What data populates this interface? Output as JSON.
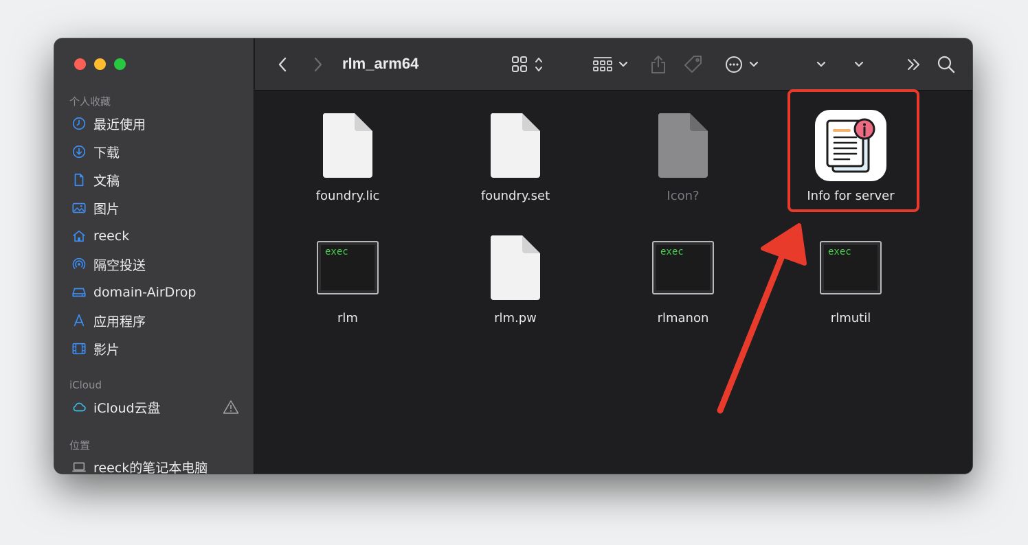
{
  "toolbar": {
    "title": "rlm_arm64",
    "back_icon": "chevron-left-icon",
    "forward_icon": "chevron-right-icon"
  },
  "sidebar": {
    "favorites_title": "个人收藏",
    "favorites": [
      {
        "label": "最近使用",
        "icon": "clock-icon"
      },
      {
        "label": "下载",
        "icon": "download-icon"
      },
      {
        "label": "文稿",
        "icon": "document-icon"
      },
      {
        "label": "图片",
        "icon": "photo-icon"
      },
      {
        "label": "reeck",
        "icon": "home-icon"
      },
      {
        "label": "隔空投送",
        "icon": "airdrop-icon"
      },
      {
        "label": "domain-AirDrop",
        "icon": "drive-icon"
      },
      {
        "label": "应用程序",
        "icon": "applications-icon"
      },
      {
        "label": "影片",
        "icon": "film-icon"
      }
    ],
    "icloud_title": "iCloud",
    "icloud_item": {
      "label": "iCloud云盘",
      "icon": "cloud-icon"
    },
    "locations_title": "位置",
    "locations_item": {
      "label": "reeck的笔记本电脑",
      "icon": "laptop-icon"
    }
  },
  "files": [
    {
      "name": "foundry.lic",
      "kind": "document"
    },
    {
      "name": "foundry.set",
      "kind": "document"
    },
    {
      "name": "Icon?",
      "kind": "document-dim"
    },
    {
      "name": "Info for server",
      "kind": "app"
    },
    {
      "name": "rlm",
      "kind": "exec"
    },
    {
      "name": "rlm.pw",
      "kind": "document"
    },
    {
      "name": "rlmanon",
      "kind": "exec"
    },
    {
      "name": "rlmutil",
      "kind": "exec"
    }
  ],
  "exec_badge": "exec",
  "colors": {
    "highlight": "#e83b2c",
    "sidebar_bg": "#3b3a3d",
    "content_bg": "#1e1e21",
    "accent_blue": "#3d8ff5"
  }
}
